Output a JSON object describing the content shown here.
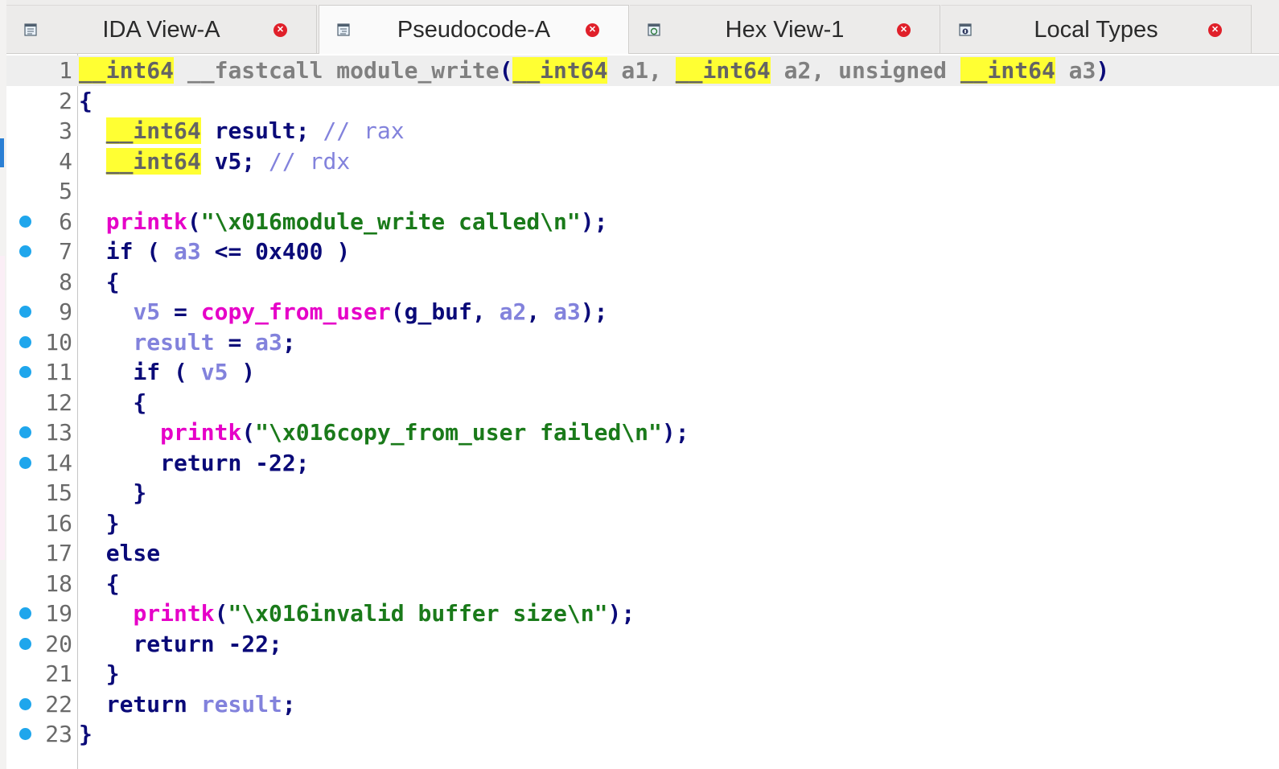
{
  "tabs": [
    {
      "label": "IDA View-A",
      "icon": "ida-view-icon",
      "active": false
    },
    {
      "label": "Pseudocode-A",
      "icon": "pseudocode-icon",
      "active": true
    },
    {
      "label": "Hex View-1",
      "icon": "hex-view-icon",
      "active": false
    },
    {
      "label": "Local Types",
      "icon": "local-types-icon",
      "active": false
    }
  ],
  "code": {
    "lines": [
      {
        "n": "1",
        "dot": false,
        "tokens": [
          {
            "c": "hl",
            "t": "__int64"
          },
          {
            "c": "punct",
            "t": " "
          },
          {
            "c": "ident",
            "t": "__fastcall module_write"
          },
          {
            "c": "punct",
            "t": "("
          },
          {
            "c": "hl",
            "t": "__int64"
          },
          {
            "c": "ident",
            "t": " a1, "
          },
          {
            "c": "hl",
            "t": "__int64"
          },
          {
            "c": "ident",
            "t": " a2, unsigned "
          },
          {
            "c": "hl",
            "t": "__int64"
          },
          {
            "c": "ident",
            "t": " a3"
          },
          {
            "c": "punct",
            "t": ")"
          }
        ]
      },
      {
        "n": "2",
        "dot": false,
        "tokens": [
          {
            "c": "punct",
            "t": "{"
          }
        ]
      },
      {
        "n": "3",
        "dot": false,
        "tokens": [
          {
            "c": "punct",
            "t": "  "
          },
          {
            "c": "hl",
            "t": "__int64"
          },
          {
            "c": "punct",
            "t": " result; "
          },
          {
            "c": "cmt",
            "t": "// rax"
          }
        ]
      },
      {
        "n": "4",
        "dot": false,
        "tokens": [
          {
            "c": "punct",
            "t": "  "
          },
          {
            "c": "hl",
            "t": "__int64"
          },
          {
            "c": "punct",
            "t": " v5; "
          },
          {
            "c": "cmt",
            "t": "// rdx"
          }
        ]
      },
      {
        "n": "5",
        "dot": false,
        "tokens": []
      },
      {
        "n": "6",
        "dot": true,
        "tokens": [
          {
            "c": "punct",
            "t": "  "
          },
          {
            "c": "func",
            "t": "printk"
          },
          {
            "c": "punct",
            "t": "("
          },
          {
            "c": "str",
            "t": "\"\\x016module_write called\\n\""
          },
          {
            "c": "punct",
            "t": ");"
          }
        ]
      },
      {
        "n": "7",
        "dot": true,
        "tokens": [
          {
            "c": "punct",
            "t": "  "
          },
          {
            "c": "kw",
            "t": "if"
          },
          {
            "c": "punct",
            "t": " ( "
          },
          {
            "c": "var",
            "t": "a3"
          },
          {
            "c": "punct",
            "t": " <= "
          },
          {
            "c": "num",
            "t": "0x400"
          },
          {
            "c": "punct",
            "t": " )"
          }
        ]
      },
      {
        "n": "8",
        "dot": false,
        "tokens": [
          {
            "c": "punct",
            "t": "  {"
          }
        ]
      },
      {
        "n": "9",
        "dot": true,
        "tokens": [
          {
            "c": "punct",
            "t": "    "
          },
          {
            "c": "var",
            "t": "v5"
          },
          {
            "c": "punct",
            "t": " = "
          },
          {
            "c": "func",
            "t": "copy_from_user"
          },
          {
            "c": "punct",
            "t": "("
          },
          {
            "c": "glob",
            "t": "g_buf"
          },
          {
            "c": "punct",
            "t": ", "
          },
          {
            "c": "var",
            "t": "a2"
          },
          {
            "c": "punct",
            "t": ", "
          },
          {
            "c": "var",
            "t": "a3"
          },
          {
            "c": "punct",
            "t": ");"
          }
        ]
      },
      {
        "n": "10",
        "dot": true,
        "tokens": [
          {
            "c": "punct",
            "t": "    "
          },
          {
            "c": "var",
            "t": "result"
          },
          {
            "c": "punct",
            "t": " = "
          },
          {
            "c": "var",
            "t": "a3"
          },
          {
            "c": "punct",
            "t": ";"
          }
        ]
      },
      {
        "n": "11",
        "dot": true,
        "tokens": [
          {
            "c": "punct",
            "t": "    "
          },
          {
            "c": "kw",
            "t": "if"
          },
          {
            "c": "punct",
            "t": " ( "
          },
          {
            "c": "var",
            "t": "v5"
          },
          {
            "c": "punct",
            "t": " )"
          }
        ]
      },
      {
        "n": "12",
        "dot": false,
        "tokens": [
          {
            "c": "punct",
            "t": "    {"
          }
        ]
      },
      {
        "n": "13",
        "dot": true,
        "tokens": [
          {
            "c": "punct",
            "t": "      "
          },
          {
            "c": "func",
            "t": "printk"
          },
          {
            "c": "punct",
            "t": "("
          },
          {
            "c": "str",
            "t": "\"\\x016copy_from_user failed\\n\""
          },
          {
            "c": "punct",
            "t": ");"
          }
        ]
      },
      {
        "n": "14",
        "dot": true,
        "tokens": [
          {
            "c": "punct",
            "t": "      "
          },
          {
            "c": "kw",
            "t": "return"
          },
          {
            "c": "punct",
            "t": " "
          },
          {
            "c": "num",
            "t": "-22"
          },
          {
            "c": "punct",
            "t": ";"
          }
        ]
      },
      {
        "n": "15",
        "dot": false,
        "tokens": [
          {
            "c": "punct",
            "t": "    }"
          }
        ]
      },
      {
        "n": "16",
        "dot": false,
        "tokens": [
          {
            "c": "punct",
            "t": "  }"
          }
        ]
      },
      {
        "n": "17",
        "dot": false,
        "tokens": [
          {
            "c": "punct",
            "t": "  "
          },
          {
            "c": "kw",
            "t": "else"
          }
        ]
      },
      {
        "n": "18",
        "dot": false,
        "tokens": [
          {
            "c": "punct",
            "t": "  {"
          }
        ]
      },
      {
        "n": "19",
        "dot": true,
        "tokens": [
          {
            "c": "punct",
            "t": "    "
          },
          {
            "c": "func",
            "t": "printk"
          },
          {
            "c": "punct",
            "t": "("
          },
          {
            "c": "str",
            "t": "\"\\x016invalid buffer size\\n\""
          },
          {
            "c": "punct",
            "t": ");"
          }
        ]
      },
      {
        "n": "20",
        "dot": true,
        "tokens": [
          {
            "c": "punct",
            "t": "    "
          },
          {
            "c": "kw",
            "t": "return"
          },
          {
            "c": "punct",
            "t": " "
          },
          {
            "c": "num",
            "t": "-22"
          },
          {
            "c": "punct",
            "t": ";"
          }
        ]
      },
      {
        "n": "21",
        "dot": false,
        "tokens": [
          {
            "c": "punct",
            "t": "  }"
          }
        ]
      },
      {
        "n": "22",
        "dot": true,
        "tokens": [
          {
            "c": "punct",
            "t": "  "
          },
          {
            "c": "kw",
            "t": "return"
          },
          {
            "c": "punct",
            "t": " "
          },
          {
            "c": "var",
            "t": "result"
          },
          {
            "c": "punct",
            "t": ";"
          }
        ]
      },
      {
        "n": "23",
        "dot": true,
        "tokens": [
          {
            "c": "punct",
            "t": "}"
          }
        ]
      }
    ]
  },
  "colors": {
    "highlight": "#ffff33",
    "breakpoint_dot": "#1fa6ec",
    "close_button": "#e0202a",
    "function": "#e600c8",
    "string": "#1a7a1a",
    "variable": "#8282dc",
    "keyword": "#0a0a78"
  }
}
